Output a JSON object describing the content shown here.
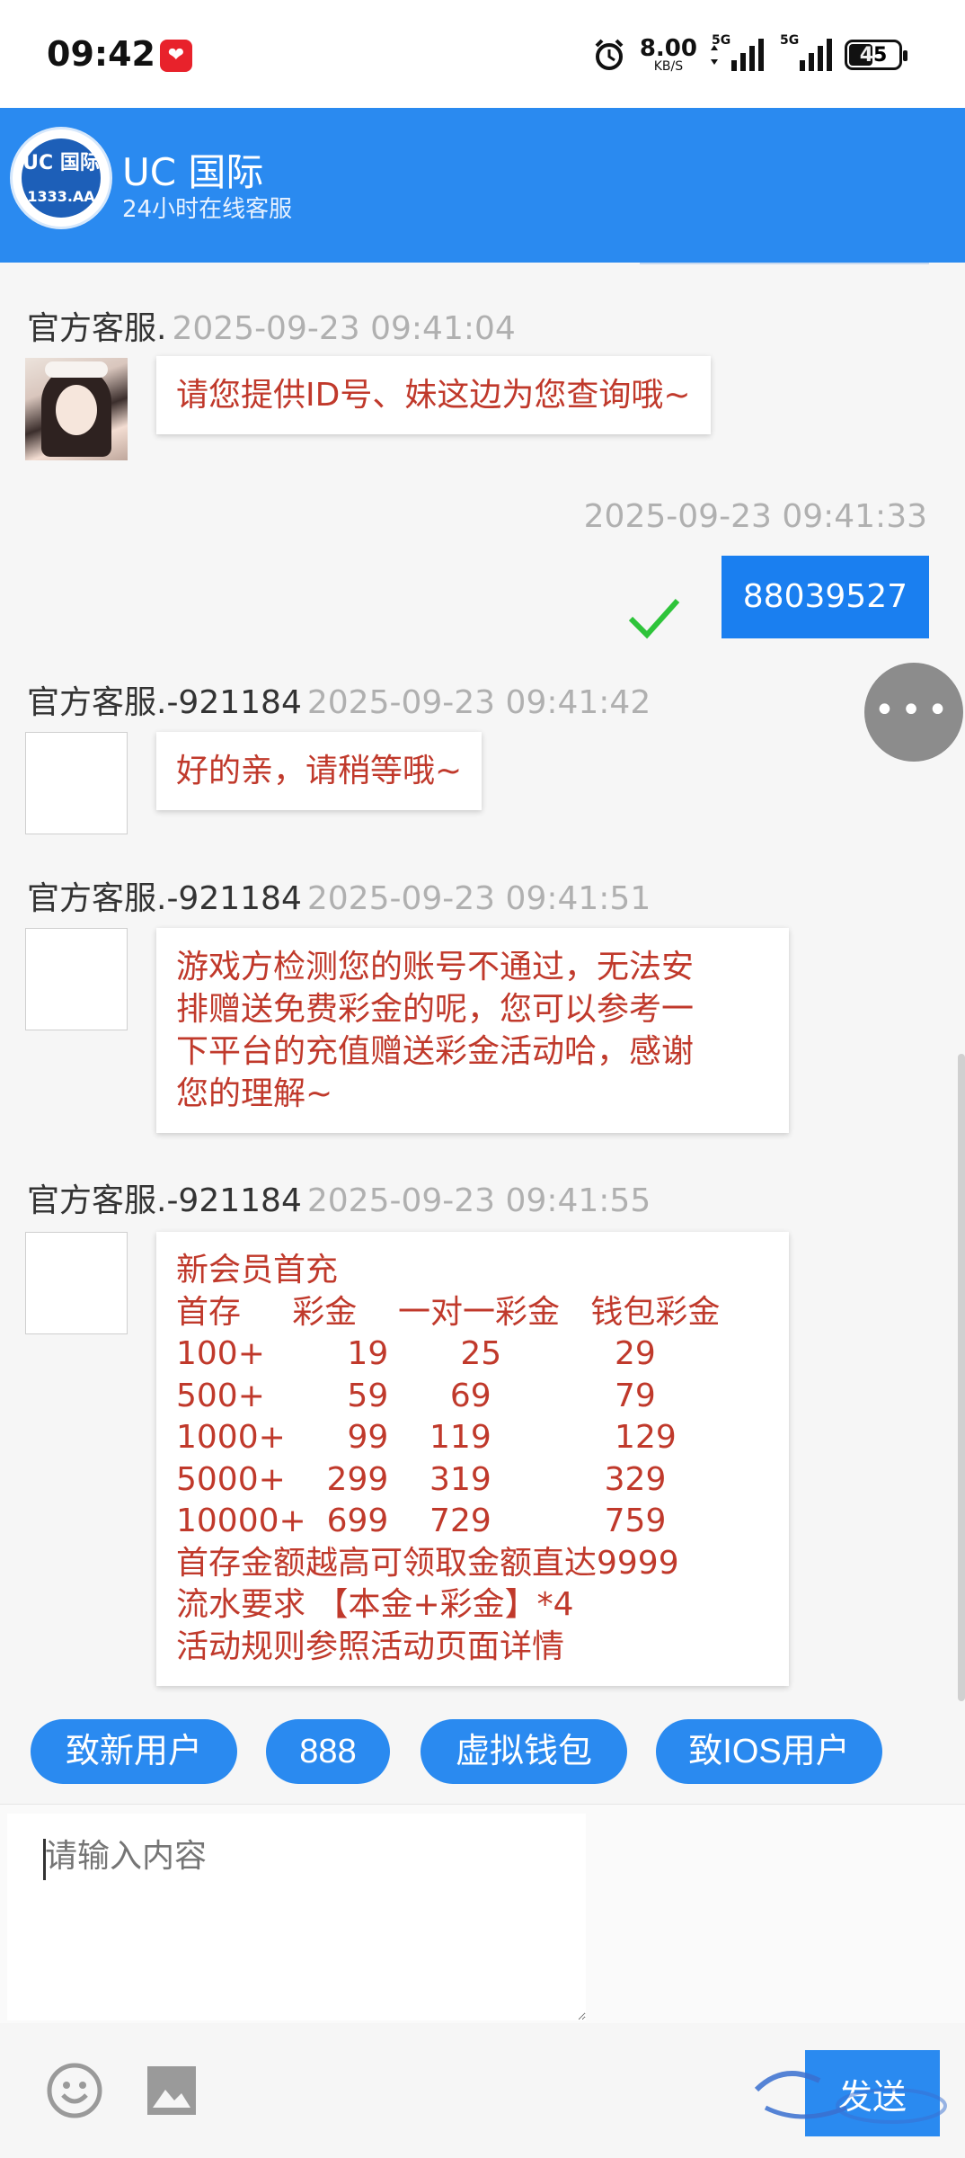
{
  "status_bar": {
    "time": "09:42",
    "net_speed": "8.00",
    "net_unit": "KB/S",
    "signal_1_label": "5G",
    "signal_2_label": "5G",
    "battery": "45"
  },
  "header": {
    "logo_text": "UC 国际",
    "logo_sub": "1333.AA",
    "title": "UC 国际",
    "subtitle": "24小时在线客服"
  },
  "messages": [
    {
      "sender": "官方客服.",
      "timestamp": "2025-09-23 09:41:04",
      "lines": [
        "请您提供ID号、妹这边为您查询哦~"
      ]
    },
    {
      "sender": "",
      "timestamp": "2025-09-23 09:41:33",
      "text": "88039527",
      "mine": true
    },
    {
      "sender": "官方客服.-921184",
      "timestamp": "2025-09-23 09:41:42",
      "lines": [
        "好的亲，请稍等哦~"
      ]
    },
    {
      "sender": "官方客服.-921184",
      "timestamp": "2025-09-23 09:41:51",
      "lines": [
        "游戏方检测您的账号不通过，无法安",
        "排赠送免费彩金的呢，您可以参考一",
        "下平台的充值赠送彩金活动哈，感谢",
        "您的理解~"
      ]
    },
    {
      "sender": "官方客服.-921184",
      "timestamp": "2025-09-23 09:41:55",
      "lines": [
        "新会员首充",
        "首存     彩金    一对一彩金   钱包彩金",
        "100+        19       25           29",
        "500+        59      69            79",
        "1000+      99    119            129",
        "5000+    299    319           329",
        "10000+  699    729           759",
        "首存金额越高可领取金额直达9999",
        "流水要求 【本金+彩金】*4",
        "活动规则参照活动页面详情"
      ]
    }
  ],
  "quick_replies": [
    "致新用户",
    "888",
    "虚拟钱包",
    "致IOS用户"
  ],
  "input": {
    "placeholder": "请输入内容"
  },
  "send_label": "发送",
  "colors": {
    "brand": "#2a8af0",
    "agent_text": "#c0392b",
    "my_bubble": "#1a7ff0"
  }
}
